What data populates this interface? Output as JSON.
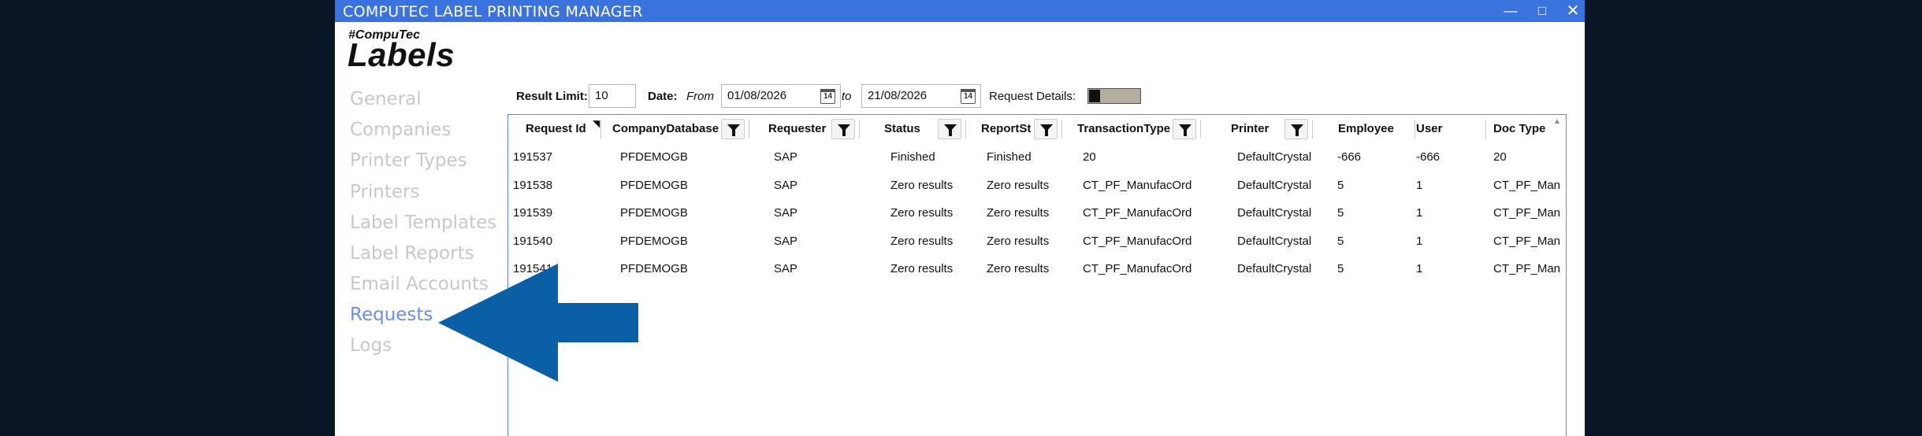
{
  "window": {
    "title": "COMPUTEC LABEL PRINTING MANAGER",
    "minimize_glyph": "—",
    "maximize_glyph": "□",
    "close_glyph": "✕"
  },
  "logo": {
    "top": "#CompuTec",
    "main": "Labels"
  },
  "nav": {
    "items": [
      {
        "label": "General"
      },
      {
        "label": "Companies"
      },
      {
        "label": "Printer Types"
      },
      {
        "label": "Printers"
      },
      {
        "label": "Label Templates"
      },
      {
        "label": "Label Reports"
      },
      {
        "label": "Email Accounts"
      },
      {
        "label": "Requests"
      },
      {
        "label": "Logs"
      }
    ],
    "active": "Requests"
  },
  "filters": {
    "result_limit_label": "Result Limit:",
    "result_limit_value": "10",
    "date_label": "Date:",
    "from_label": "From",
    "from_value": "01/08/2026",
    "to_label": "to",
    "to_value": "21/08/2026",
    "calendar_day": "14",
    "request_details_label": "Request Details:",
    "request_details_on": false
  },
  "grid": {
    "columns": [
      {
        "label": "Request Id"
      },
      {
        "label": "CompanyDatabase"
      },
      {
        "label": "Requester"
      },
      {
        "label": "Status"
      },
      {
        "label": "ReportSt"
      },
      {
        "label": "TransactionType"
      },
      {
        "label": "Printer"
      },
      {
        "label": "Employee"
      },
      {
        "label": "User"
      },
      {
        "label": "Doc Type"
      }
    ],
    "sort_glyph": "◥",
    "scroll_up_glyph": "▲",
    "rows": [
      [
        "191537",
        "PFDEMOGB",
        "SAP",
        "Finished",
        "Finished",
        "20",
        "DefaultCrystal",
        "-666",
        "-666",
        "20"
      ],
      [
        "191538",
        "PFDEMOGB",
        "SAP",
        "Zero results",
        "Zero results",
        "CT_PF_ManufacOrd",
        "DefaultCrystal",
        "5",
        "1",
        "CT_PF_Man"
      ],
      [
        "191539",
        "PFDEMOGB",
        "SAP",
        "Zero results",
        "Zero results",
        "CT_PF_ManufacOrd",
        "DefaultCrystal",
        "5",
        "1",
        "CT_PF_Man"
      ],
      [
        "191540",
        "PFDEMOGB",
        "SAP",
        "Zero results",
        "Zero results",
        "CT_PF_ManufacOrd",
        "DefaultCrystal",
        "5",
        "1",
        "CT_PF_Man"
      ],
      [
        "191541",
        "PFDEMOGB",
        "SAP",
        "Zero results",
        "Zero results",
        "CT_PF_ManufacOrd",
        "DefaultCrystal",
        "5",
        "1",
        "CT_PF_Man"
      ]
    ]
  },
  "annotation": {
    "arrow_color": "#0b5fa5",
    "points_to": "Requests"
  }
}
